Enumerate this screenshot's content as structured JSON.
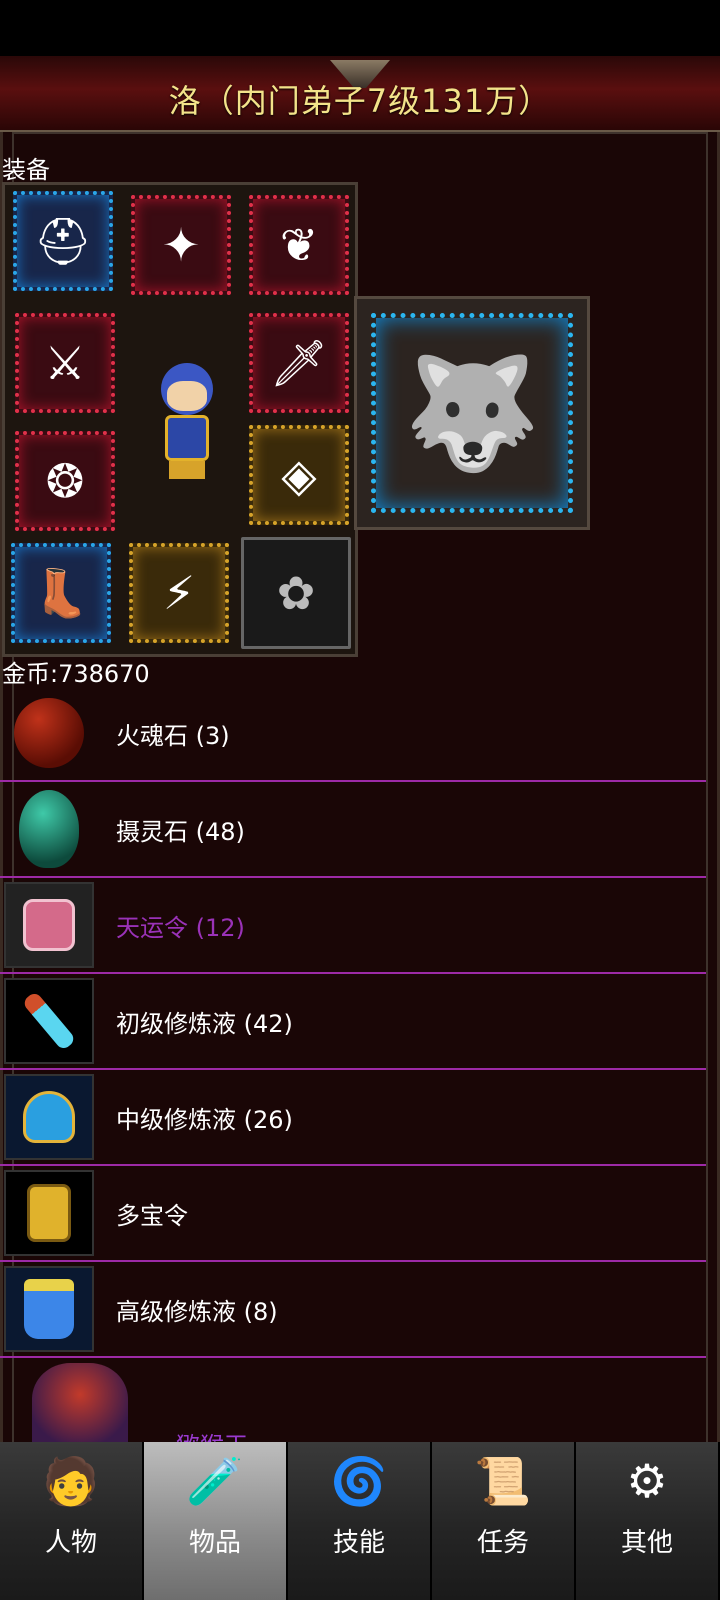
{
  "header": {
    "title": "洛（内门弟子7级131万）"
  },
  "equipment": {
    "section_label": "装备",
    "slots": [
      {
        "name": "helmet",
        "icon": "helmet-icon"
      },
      {
        "name": "armor",
        "icon": "armor-icon"
      },
      {
        "name": "necklace",
        "icon": "necklace-icon"
      },
      {
        "name": "sword",
        "icon": "sword-icon"
      },
      {
        "name": "weapon",
        "icon": "weapon-icon"
      },
      {
        "name": "bracer",
        "icon": "bracer-icon"
      },
      {
        "name": "belt",
        "icon": "belt-icon"
      },
      {
        "name": "boots",
        "icon": "boots-icon"
      },
      {
        "name": "ring",
        "icon": "ring-icon"
      },
      {
        "name": "charm",
        "icon": "charm-icon"
      }
    ],
    "mount_icon": "beast-mount-icon"
  },
  "gold": {
    "label": "金币:738670"
  },
  "items": [
    {
      "name": "火魂石 (3)",
      "icon": "red-stone-icon",
      "purple": false
    },
    {
      "name": "摄灵石 (48)",
      "icon": "green-egg-icon",
      "purple": false
    },
    {
      "name": "天运令 (12)",
      "icon": "token-icon",
      "purple": true
    },
    {
      "name": "初级修炼液 (42)",
      "icon": "vial-icon",
      "purple": false
    },
    {
      "name": "中级修炼液 (26)",
      "icon": "flask-icon",
      "purple": false
    },
    {
      "name": "多宝令",
      "icon": "gold-token-icon",
      "purple": false
    },
    {
      "name": "高级修炼液 (8)",
      "icon": "potion-icon",
      "purple": false
    }
  ],
  "partial_item": {
    "name": "猕猴王",
    "icon": "monkey-king-icon"
  },
  "tabs": [
    {
      "label": "人物",
      "icon": "character-icon",
      "active": false
    },
    {
      "label": "物品",
      "icon": "items-icon",
      "active": true
    },
    {
      "label": "技能",
      "icon": "skills-icon",
      "active": false
    },
    {
      "label": "任务",
      "icon": "quests-icon",
      "active": false
    },
    {
      "label": "其他",
      "icon": "other-icon",
      "active": false
    }
  ]
}
